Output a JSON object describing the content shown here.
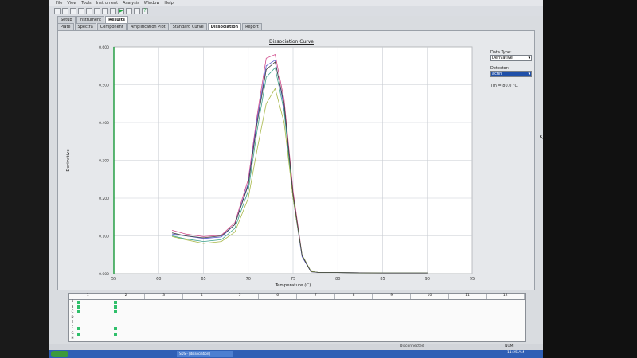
{
  "menu": [
    "File",
    "View",
    "Tools",
    "Instrument",
    "Analysis",
    "Window",
    "Help"
  ],
  "tabs_top": [
    {
      "label": "Setup",
      "active": false
    },
    {
      "label": "Instrument",
      "active": false
    },
    {
      "label": "Results",
      "active": true
    }
  ],
  "tabs_sub": [
    {
      "label": "Plate",
      "active": false
    },
    {
      "label": "Spectra",
      "active": false
    },
    {
      "label": "Component",
      "active": false
    },
    {
      "label": "Amplification Plot",
      "active": false
    },
    {
      "label": "Standard Curve",
      "active": false
    },
    {
      "label": "Dissociation",
      "active": true
    },
    {
      "label": "Report",
      "active": false
    }
  ],
  "chart_title": "Dissociation Curve",
  "side": {
    "data_type_label": "Data Type:",
    "data_type_value": "Derivative",
    "detector_label": "Detector:",
    "detector_value": "actin",
    "tm_text": "Tm = 80.0 °C"
  },
  "chart_data": {
    "type": "line",
    "title": "Dissociation Curve",
    "xlabel": "Temperature (C)",
    "ylabel": "Derivative",
    "xlim": [
      55,
      95
    ],
    "ylim": [
      0,
      0.6
    ],
    "xticks": [
      55,
      60,
      65,
      70,
      75,
      80,
      85,
      90,
      95
    ],
    "yticks": [
      0.0,
      0.1,
      0.2,
      0.3,
      0.4,
      0.5,
      0.6
    ],
    "ytick_labels": [
      "0.000",
      "0.100",
      "0.200",
      "0.300",
      "0.400",
      "0.500",
      "0.600"
    ],
    "grid": true,
    "series": [
      {
        "color": "#d04a8a",
        "x": [
          61.5,
          63,
          65,
          67,
          68.5,
          70,
          71,
          72,
          73,
          74,
          75,
          76,
          77,
          78,
          80,
          85,
          90
        ],
        "y": [
          0.115,
          0.105,
          0.098,
          0.102,
          0.135,
          0.25,
          0.42,
          0.57,
          0.58,
          0.46,
          0.22,
          0.05,
          0.006,
          0.003,
          0.003,
          0.002,
          0.002
        ]
      },
      {
        "color": "#5a5ad0",
        "x": [
          61.5,
          63,
          65,
          67,
          68.5,
          70,
          71,
          72,
          73,
          74,
          75,
          76,
          77,
          78,
          80,
          85,
          90
        ],
        "y": [
          0.105,
          0.1,
          0.093,
          0.097,
          0.13,
          0.24,
          0.41,
          0.55,
          0.565,
          0.44,
          0.2,
          0.045,
          0.005,
          0.003,
          0.003,
          0.002,
          0.002
        ]
      },
      {
        "color": "#3aa08a",
        "x": [
          61.5,
          63,
          65,
          67,
          68.5,
          70,
          71,
          72,
          73,
          74,
          75,
          76,
          77,
          78,
          80,
          85,
          90
        ],
        "y": [
          0.1,
          0.092,
          0.085,
          0.09,
          0.12,
          0.22,
          0.38,
          0.52,
          0.545,
          0.43,
          0.2,
          0.05,
          0.006,
          0.003,
          0.003,
          0.002,
          0.002
        ]
      },
      {
        "color": "#a8b84a",
        "x": [
          61.5,
          63,
          65,
          67,
          68.5,
          70,
          71,
          72,
          73,
          74,
          75,
          76,
          77,
          78,
          80,
          85,
          90
        ],
        "y": [
          0.098,
          0.09,
          0.08,
          0.085,
          0.11,
          0.2,
          0.33,
          0.45,
          0.49,
          0.4,
          0.2,
          0.05,
          0.006,
          0.003,
          0.003,
          0.002,
          0.002
        ]
      },
      {
        "color": "#404040",
        "x": [
          61.5,
          63,
          65,
          67,
          68.5,
          70,
          71,
          72,
          73,
          74,
          75,
          76,
          77,
          78,
          80,
          85,
          90
        ],
        "y": [
          0.108,
          0.1,
          0.095,
          0.1,
          0.13,
          0.235,
          0.4,
          0.54,
          0.56,
          0.45,
          0.21,
          0.048,
          0.005,
          0.003,
          0.003,
          0.002,
          0.002
        ]
      }
    ]
  },
  "plate": {
    "columns": [
      "1",
      "2",
      "3",
      "4",
      "5",
      "6",
      "7",
      "8",
      "9",
      "10",
      "11",
      "12"
    ],
    "rows": [
      "A",
      "B",
      "C",
      "D",
      "E",
      "F",
      "G",
      "H"
    ]
  },
  "status": {
    "text": "Disconnected",
    "app": "NUM",
    "clock": "11:25 AM"
  },
  "taskbar": {
    "item": "SDS - [dissociation]"
  }
}
